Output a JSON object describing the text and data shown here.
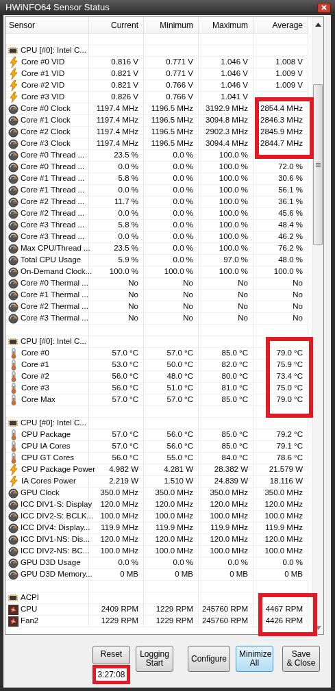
{
  "window": {
    "title": "HWiNFO64 Sensor Status"
  },
  "columns": [
    "Sensor",
    "Current",
    "Minimum",
    "Maximum",
    "Average"
  ],
  "sections": [
    {
      "title": "CPU [#0]: Intel C...",
      "kind": "chip",
      "rows": [
        {
          "kind": "voltage",
          "name": "Core #0 VID",
          "values": [
            "0.816 V",
            "0.771 V",
            "1.046 V",
            "1.008 V"
          ]
        },
        {
          "kind": "voltage",
          "name": "Core #1 VID",
          "values": [
            "0.821 V",
            "0.771 V",
            "1.046 V",
            "1.009 V"
          ]
        },
        {
          "kind": "voltage",
          "name": "Core #2 VID",
          "values": [
            "0.821 V",
            "0.766 V",
            "1.046 V",
            "1.009 V"
          ]
        },
        {
          "kind": "voltage",
          "name": "Core #3 VID",
          "values": [
            "0.826 V",
            "0.766 V",
            "1.041 V"
          ]
        },
        {
          "kind": "gauge",
          "name": "Core #0 Clock",
          "values": [
            "1197.4 MHz",
            "1196.5 MHz",
            "3192.9 MHz",
            "2854.4 MHz"
          ]
        },
        {
          "kind": "gauge",
          "name": "Core #1 Clock",
          "values": [
            "1197.4 MHz",
            "1196.5 MHz",
            "3094.8 MHz",
            "2846.3 MHz"
          ]
        },
        {
          "kind": "gauge",
          "name": "Core #2 Clock",
          "values": [
            "1197.4 MHz",
            "1196.5 MHz",
            "2902.3 MHz",
            "2845.9 MHz"
          ]
        },
        {
          "kind": "gauge",
          "name": "Core #3 Clock",
          "values": [
            "1197.4 MHz",
            "1196.5 MHz",
            "3094.4 MHz",
            "2844.7 MHz"
          ]
        },
        {
          "kind": "gauge",
          "name": "Core #0 Thread ...",
          "values": [
            "23.5 %",
            "0.0 %",
            "100.0 %"
          ]
        },
        {
          "kind": "gauge",
          "name": "Core #0 Thread ...",
          "values": [
            "0.0 %",
            "0.0 %",
            "100.0 %",
            "72.0 %"
          ]
        },
        {
          "kind": "gauge",
          "name": "Core #1 Thread ...",
          "values": [
            "5.8 %",
            "0.0 %",
            "100.0 %",
            "30.6 %"
          ]
        },
        {
          "kind": "gauge",
          "name": "Core #1 Thread ...",
          "values": [
            "0.0 %",
            "0.0 %",
            "100.0 %",
            "56.1 %"
          ]
        },
        {
          "kind": "gauge",
          "name": "Core #2 Thread ...",
          "values": [
            "11.7 %",
            "0.0 %",
            "100.0 %",
            "36.1 %"
          ]
        },
        {
          "kind": "gauge",
          "name": "Core #2 Thread ...",
          "values": [
            "0.0 %",
            "0.0 %",
            "100.0 %",
            "45.6 %"
          ]
        },
        {
          "kind": "gauge",
          "name": "Core #3 Thread ...",
          "values": [
            "5.8 %",
            "0.0 %",
            "100.0 %",
            "48.4 %"
          ]
        },
        {
          "kind": "gauge",
          "name": "Core #3 Thread ...",
          "values": [
            "0.0 %",
            "0.0 %",
            "100.0 %",
            "46.2 %"
          ]
        },
        {
          "kind": "gauge",
          "name": "Max CPU/Thread ...",
          "values": [
            "23.5 %",
            "0.0 %",
            "100.0 %",
            "76.2 %"
          ]
        },
        {
          "kind": "gauge",
          "name": "Total CPU Usage",
          "values": [
            "5.9 %",
            "0.0 %",
            "97.0 %",
            "48.0 %"
          ]
        },
        {
          "kind": "gauge",
          "name": "On-Demand Clock...",
          "values": [
            "100.0 %",
            "100.0 %",
            "100.0 %",
            "100.0 %"
          ]
        },
        {
          "kind": "gauge",
          "name": "Core #0 Thermal ...",
          "values": [
            "No",
            "No",
            "No",
            "No"
          ]
        },
        {
          "kind": "gauge",
          "name": "Core #1 Thermal ...",
          "values": [
            "No",
            "No",
            "No",
            "No"
          ]
        },
        {
          "kind": "gauge",
          "name": "Core #2 Thermal ...",
          "values": [
            "No",
            "No",
            "No",
            "No"
          ]
        },
        {
          "kind": "gauge",
          "name": "Core #3 Thermal ...",
          "values": [
            "No",
            "No",
            "No",
            "No"
          ]
        }
      ]
    },
    {
      "title": "CPU [#0]: Intel C...",
      "kind": "chip",
      "rows": [
        {
          "kind": "temperature",
          "name": "Core #0",
          "values": [
            "57.0 °C",
            "57.0 °C",
            "85.0 °C",
            "79.0 °C"
          ]
        },
        {
          "kind": "temperature",
          "name": "Core #1",
          "values": [
            "53.0 °C",
            "50.0 °C",
            "82.0 °C",
            "75.9 °C"
          ]
        },
        {
          "kind": "temperature",
          "name": "Core #2",
          "values": [
            "56.0 °C",
            "48.0 °C",
            "80.0 °C",
            "73.4 °C"
          ]
        },
        {
          "kind": "temperature",
          "name": "Core #3",
          "values": [
            "56.0 °C",
            "51.0 °C",
            "81.0 °C",
            "75.0 °C"
          ]
        },
        {
          "kind": "temperature",
          "name": "Core Max",
          "values": [
            "57.0 °C",
            "57.0 °C",
            "85.0 °C",
            "79.0 °C"
          ]
        }
      ]
    },
    {
      "title": "CPU [#0]: Intel C...",
      "kind": "chip",
      "rows": [
        {
          "kind": "temperature",
          "name": "CPU Package",
          "values": [
            "57.0 °C",
            "56.0 °C",
            "85.0 °C",
            "79.2 °C"
          ]
        },
        {
          "kind": "temperature",
          "name": "CPU IA Cores",
          "values": [
            "57.0 °C",
            "56.0 °C",
            "85.0 °C",
            "79.1 °C"
          ]
        },
        {
          "kind": "temperature",
          "name": "CPU GT Cores",
          "values": [
            "56.0 °C",
            "55.0 °C",
            "84.0 °C",
            "78.6 °C"
          ]
        },
        {
          "kind": "voltage",
          "name": "CPU Package Power",
          "values": [
            "4.982 W",
            "4.281 W",
            "28.382 W",
            "21.579 W"
          ]
        },
        {
          "kind": "voltage",
          "name": "IA Cores Power",
          "values": [
            "2.219 W",
            "1.510 W",
            "24.839 W",
            "18.116 W"
          ]
        },
        {
          "kind": "gauge",
          "name": "GPU Clock",
          "values": [
            "350.0 MHz",
            "350.0 MHz",
            "350.0 MHz",
            "350.0 MHz"
          ]
        },
        {
          "kind": "gauge",
          "name": "ICC DIV1-S: Display",
          "values": [
            "120.0 MHz",
            "120.0 MHz",
            "120.0 MHz",
            "120.0 MHz"
          ]
        },
        {
          "kind": "gauge",
          "name": "ICC DIV2-S: BCLK...",
          "values": [
            "100.0 MHz",
            "100.0 MHz",
            "100.0 MHz",
            "100.0 MHz"
          ]
        },
        {
          "kind": "gauge",
          "name": "ICC DIV4: Display...",
          "values": [
            "119.9 MHz",
            "119.9 MHz",
            "119.9 MHz",
            "119.9 MHz"
          ]
        },
        {
          "kind": "gauge",
          "name": "ICC DIV1-NS: Dis...",
          "values": [
            "120.0 MHz",
            "120.0 MHz",
            "120.0 MHz",
            "120.0 MHz"
          ]
        },
        {
          "kind": "gauge",
          "name": "ICC DIV2-NS: BC...",
          "values": [
            "100.0 MHz",
            "100.0 MHz",
            "100.0 MHz",
            "100.0 MHz"
          ]
        },
        {
          "kind": "gauge",
          "name": "GPU D3D Usage",
          "values": [
            "0.0 %",
            "0.0 %",
            "0.0 %",
            "0.0 %"
          ]
        },
        {
          "kind": "gauge",
          "name": "GPU D3D Memory...",
          "values": [
            "0 MB",
            "0 MB",
            "0 MB",
            "0 MB"
          ]
        }
      ]
    },
    {
      "title": "ACPI",
      "kind": "chip",
      "rows": [
        {
          "kind": "fan",
          "name": "CPU",
          "values": [
            "2409 RPM",
            "1229 RPM",
            "245760 RPM",
            "4467 RPM"
          ]
        },
        {
          "kind": "fan",
          "name": "Fan2",
          "values": [
            "1229 RPM",
            "1229 RPM",
            "245760 RPM",
            "4426 RPM"
          ]
        }
      ]
    }
  ],
  "buttons": [
    {
      "label": "Reset",
      "selected": false
    },
    {
      "label": "Logging\nStart",
      "selected": false
    },
    {
      "label": "Configure",
      "selected": false
    },
    {
      "label": "Minimize\nAll",
      "selected": true
    },
    {
      "label": "Save\n& Close",
      "selected": false
    }
  ],
  "timer": "3:27:08"
}
